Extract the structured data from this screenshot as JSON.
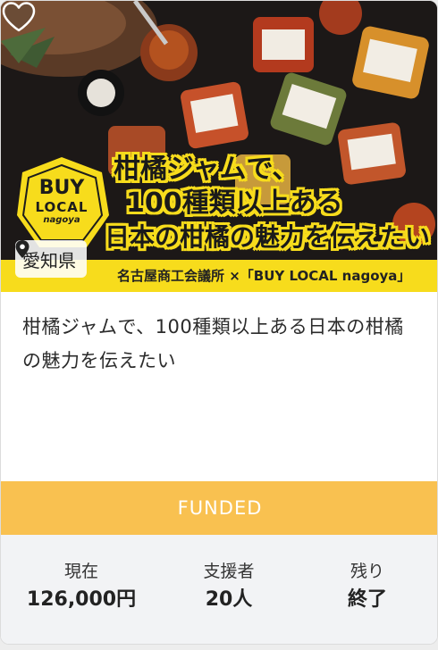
{
  "card": {
    "banner": {
      "lines": [
        "柑橘ジャムで、",
        "100種類以上ある",
        "日本の柑橘の魅力を伝えたい"
      ],
      "logo_text_1": "BUY",
      "logo_text_2": "LOCAL",
      "logo_text_3": "nagoya",
      "credit": "名古屋商工会議所 ×「BUY LOCAL nagoya」"
    },
    "location": "愛知県",
    "favorite_icon": "heart-icon",
    "title": "柑橘ジャムで、100種類以上ある日本の柑橘の魅力を伝えたい",
    "status": "FUNDED",
    "stats": {
      "current_label": "現在",
      "current_value": "126,000円",
      "backers_label": "支援者",
      "backers_value": "20人",
      "remaining_label": "残り",
      "remaining_value": "終了"
    }
  },
  "colors": {
    "status_bar": "#f9c150",
    "banner_yellow": "#f7dc1c",
    "stats_bg": "#f2f3f5"
  }
}
